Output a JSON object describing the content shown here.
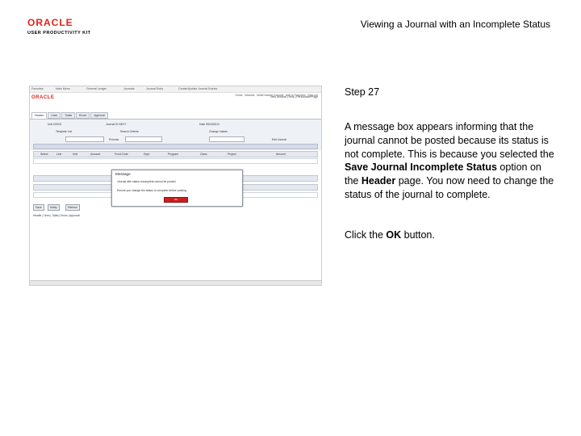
{
  "header": {
    "logo_oracle": "ORACLE",
    "logo_upk": "USER PRODUCTIVITY KIT",
    "title": "Viewing a Journal with an Incomplete Status"
  },
  "screenshot": {
    "top_nav": [
      "Favorites",
      "Main Menu",
      "General Ledger",
      "Journals",
      "Journal Entry",
      "Create/Update Journal Entries"
    ],
    "brand": "ORACLE",
    "menu_items": [
      "Home",
      "Worklist",
      "MultiChannel Console",
      "Add to Favorites",
      "Sign out"
    ],
    "toolbar_right": "New Window | Help | Personalize Page",
    "tabs": [
      "Header",
      "Lines",
      "Totals",
      "Errors",
      "Approval"
    ],
    "fields": {
      "unit": "Unit US001",
      "journal": "Journal ID NEXT",
      "date": "Date 05/15/2012",
      "template": "Template List",
      "search_criteria": "Search Criteria",
      "change_values": "Change Values",
      "process": "Process",
      "edit": "Edit Journal"
    },
    "grid_label": "Lines",
    "grid_columns": [
      "Select",
      "Line",
      "Unit",
      "Account",
      "Fund Code",
      "Dept",
      "Program",
      "Class",
      "Project",
      "Amount"
    ],
    "buttons_bottom": [
      "Save",
      "Notify",
      "Refresh"
    ],
    "bottom_links": "Header | Lines | Totals | Errors | Approval",
    "dialog": {
      "title": "Message",
      "line1": "Journal with status Incomplete cannot be posted.",
      "line2": "Ensure you change the status to complete before posting.",
      "ok_label": "OK"
    }
  },
  "instructions": {
    "step": "Step 27",
    "desc_1": "A message box appears informing that the journal cannot be posted because its status is not complete. This is because you selected the ",
    "desc_bold_1": "Save Journal Incomplete Status",
    "desc_2": " option on the ",
    "desc_bold_2": "Header",
    "desc_3": " page. You now need to change the status of the journal to complete.",
    "action_1": "Click the ",
    "action_bold": "OK",
    "action_2": " button."
  }
}
